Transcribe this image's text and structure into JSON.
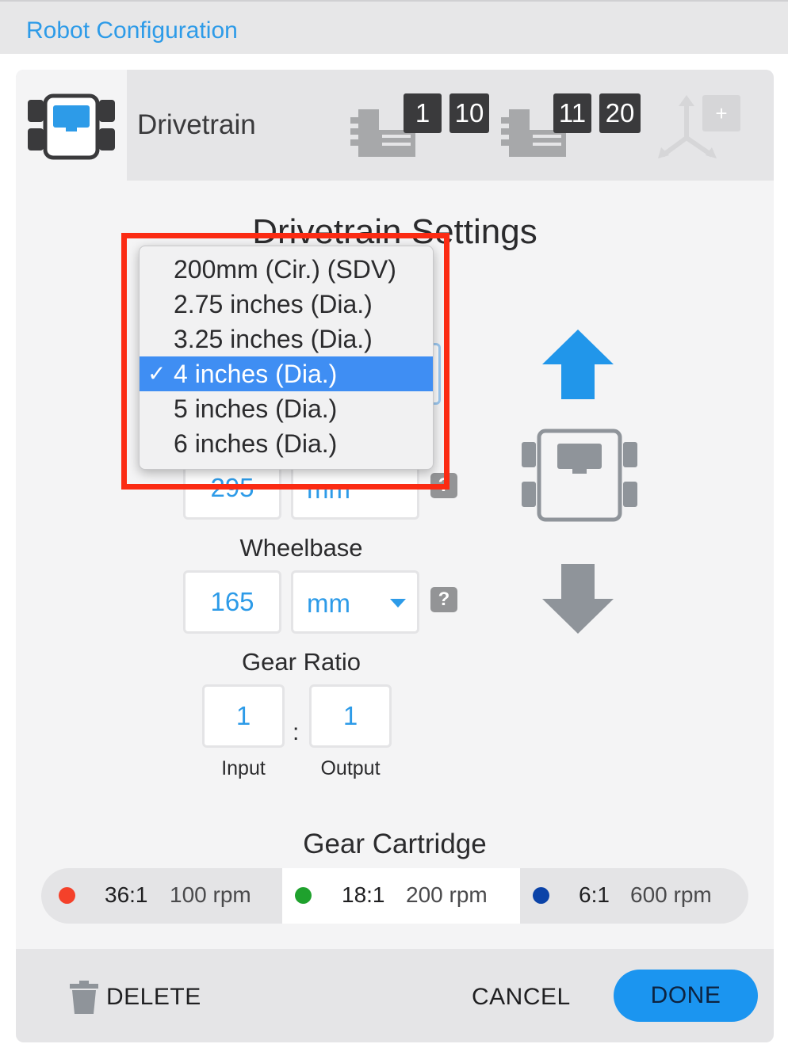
{
  "window": {
    "title": "Robot Configuration"
  },
  "tab": {
    "label": "Drivetrain"
  },
  "ports": [
    "1",
    "10",
    "11",
    "20"
  ],
  "gyro": {
    "add_label": "+"
  },
  "settings": {
    "title": "Drivetrain Settings"
  },
  "wheel_size": {
    "options": [
      "200mm (Cir.) (SDV)",
      "2.75 inches (Dia.)",
      "3.25 inches (Dia.)",
      "4 inches (Dia.)",
      "5 inches (Dia.)",
      "6 inches (Dia.)"
    ],
    "selected": "4 inches (Dia.)",
    "check": "✓"
  },
  "track_width": {
    "value": "295",
    "unit": "mm"
  },
  "wheelbase": {
    "label": "Wheelbase",
    "value": "165",
    "unit": "mm",
    "help": "?"
  },
  "gear_ratio": {
    "label": "Gear Ratio",
    "input": "1",
    "output": "1",
    "separator": ":",
    "input_label": "Input",
    "output_label": "Output"
  },
  "cartridge": {
    "title": "Gear Cartridge",
    "options": [
      {
        "ratio": "36:1",
        "rpm": "100 rpm",
        "color": "#f4412a"
      },
      {
        "ratio": "18:1",
        "rpm": "200 rpm",
        "color": "#1fa12d"
      },
      {
        "ratio": "6:1",
        "rpm": "600 rpm",
        "color": "#0b43a8"
      }
    ],
    "selected_index": 1
  },
  "footer": {
    "delete": "DELETE",
    "cancel": "CANCEL",
    "done": "DONE"
  },
  "colors": {
    "accent": "#2d9be8",
    "highlight": "#fb2b13",
    "selection": "#3f8ef3"
  }
}
